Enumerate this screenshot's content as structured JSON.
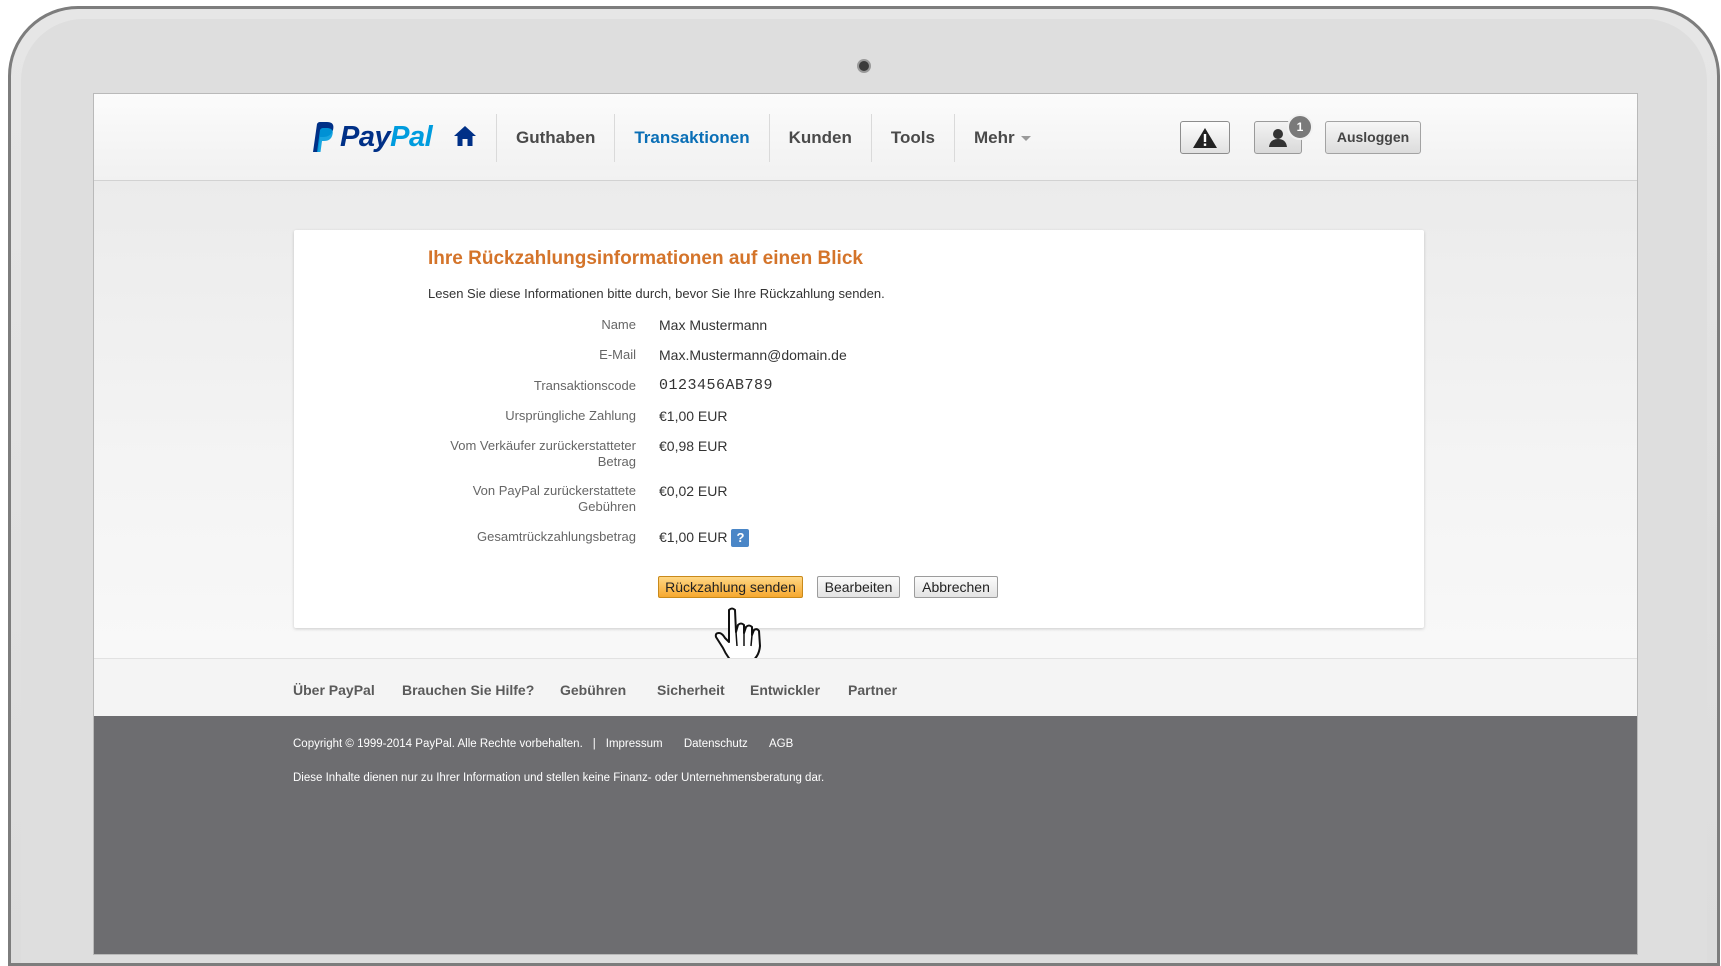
{
  "header": {
    "logo": {
      "text_pay": "Pay",
      "text_pal": "Pal"
    },
    "nav": [
      {
        "label": "Guthaben",
        "active": false
      },
      {
        "label": "Transaktionen",
        "active": true
      },
      {
        "label": "Kunden",
        "active": false
      },
      {
        "label": "Tools",
        "active": false
      },
      {
        "label": "Mehr",
        "active": false
      }
    ],
    "notification_count": "1",
    "logout_label": "Ausloggen",
    "icons": [
      "home-icon",
      "warning-icon",
      "user-icon",
      "chevron-down-icon"
    ]
  },
  "refund": {
    "title": "Ihre Rückzahlungsinformationen auf einen Blick",
    "subtitle": "Lesen Sie diese Informationen bitte durch, bevor Sie Ihre Rückzahlung senden.",
    "rows": [
      {
        "label": "Name",
        "value": "Max Mustermann"
      },
      {
        "label": "E-Mail",
        "value": "Max.Mustermann@domain.de"
      },
      {
        "label": "Transaktionscode",
        "value": "0123456AB789"
      },
      {
        "label": "Ursprüngliche Zahlung",
        "value": "€1,00 EUR"
      },
      {
        "label": "Vom Verkäufer zurückerstatteter Betrag",
        "value": "€0,98 EUR"
      },
      {
        "label": "Von PayPal zurückerstattete Gebühren",
        "value": "€0,02 EUR"
      },
      {
        "label": "Gesamtrückzahlungsbetrag",
        "value": "€1,00 EUR"
      }
    ],
    "help_label": "?",
    "buttons": {
      "send": "Rückzahlung senden",
      "edit": "Bearbeiten",
      "cancel": "Abbrechen"
    }
  },
  "footer": {
    "links": [
      "Über PayPal",
      "Brauchen Sie Hilfe?",
      "Gebühren",
      "Sicherheit",
      "Entwickler",
      "Partner"
    ],
    "copyright": "Copyright © 1999-2014 PayPal. Alle Rechte vorbehalten.",
    "separator": "|",
    "legal_links": [
      "Impressum",
      "Datenschutz",
      "AGB"
    ],
    "disclaimer": "Diese Inhalte dienen nur zu Ihrer Information und stellen keine Finanz- oder Unternehmensberatung dar."
  },
  "colors": {
    "brand_dark": "#003087",
    "brand_light": "#009cde",
    "nav_active": "#0a6fb6",
    "title_orange": "#d4742a",
    "primary_button": "#f6a830",
    "footer_dark": "#6d6d70"
  }
}
